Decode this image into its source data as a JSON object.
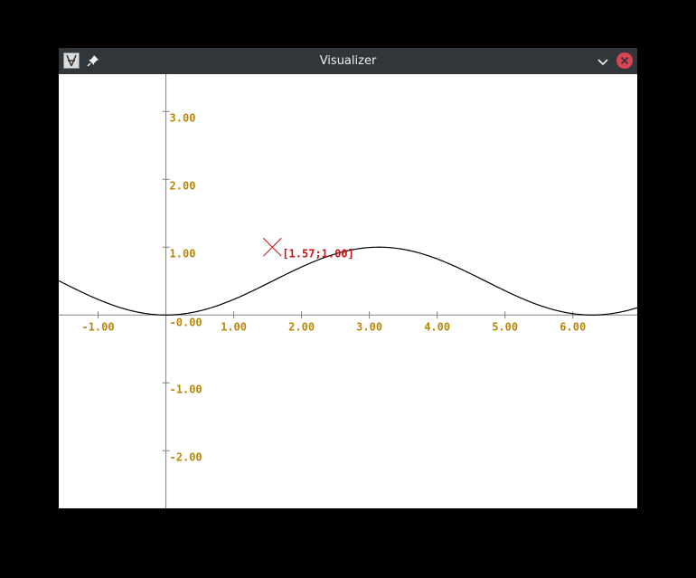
{
  "window": {
    "title": "Visualizer"
  },
  "colors": {
    "titlebar": "#31363b",
    "title_text": "#eff0f1",
    "close": "#da4453",
    "axis": "#808080",
    "tick_label": "#b8860b",
    "curve": "#000000",
    "marker": "#cc1111"
  },
  "icons": {
    "app": "app-icon",
    "pin": "pin-icon",
    "minimize": "chevron-down-icon",
    "close": "close-icon"
  },
  "chart_data": {
    "type": "line",
    "function": "(1 - cos(x)) / 2",
    "xlim": [
      -1.58,
      6.95
    ],
    "ylim": [
      -2.85,
      3.55
    ],
    "x_ticks": [
      -1,
      1,
      2,
      3,
      4,
      5,
      6
    ],
    "x_tick_labels": [
      "-1.00",
      "1.00",
      "2.00",
      "3.00",
      "4.00",
      "5.00",
      "6.00"
    ],
    "y_ticks": [
      3,
      2,
      1,
      -1,
      -2
    ],
    "y_tick_labels": [
      "3.00",
      "2.00",
      "1.00",
      "-1.00",
      "-2.00"
    ],
    "origin_label": "-0.00",
    "marker": {
      "x": 1.57,
      "y": 1.0,
      "label": "[1.57;1.00]"
    },
    "grid": false
  }
}
